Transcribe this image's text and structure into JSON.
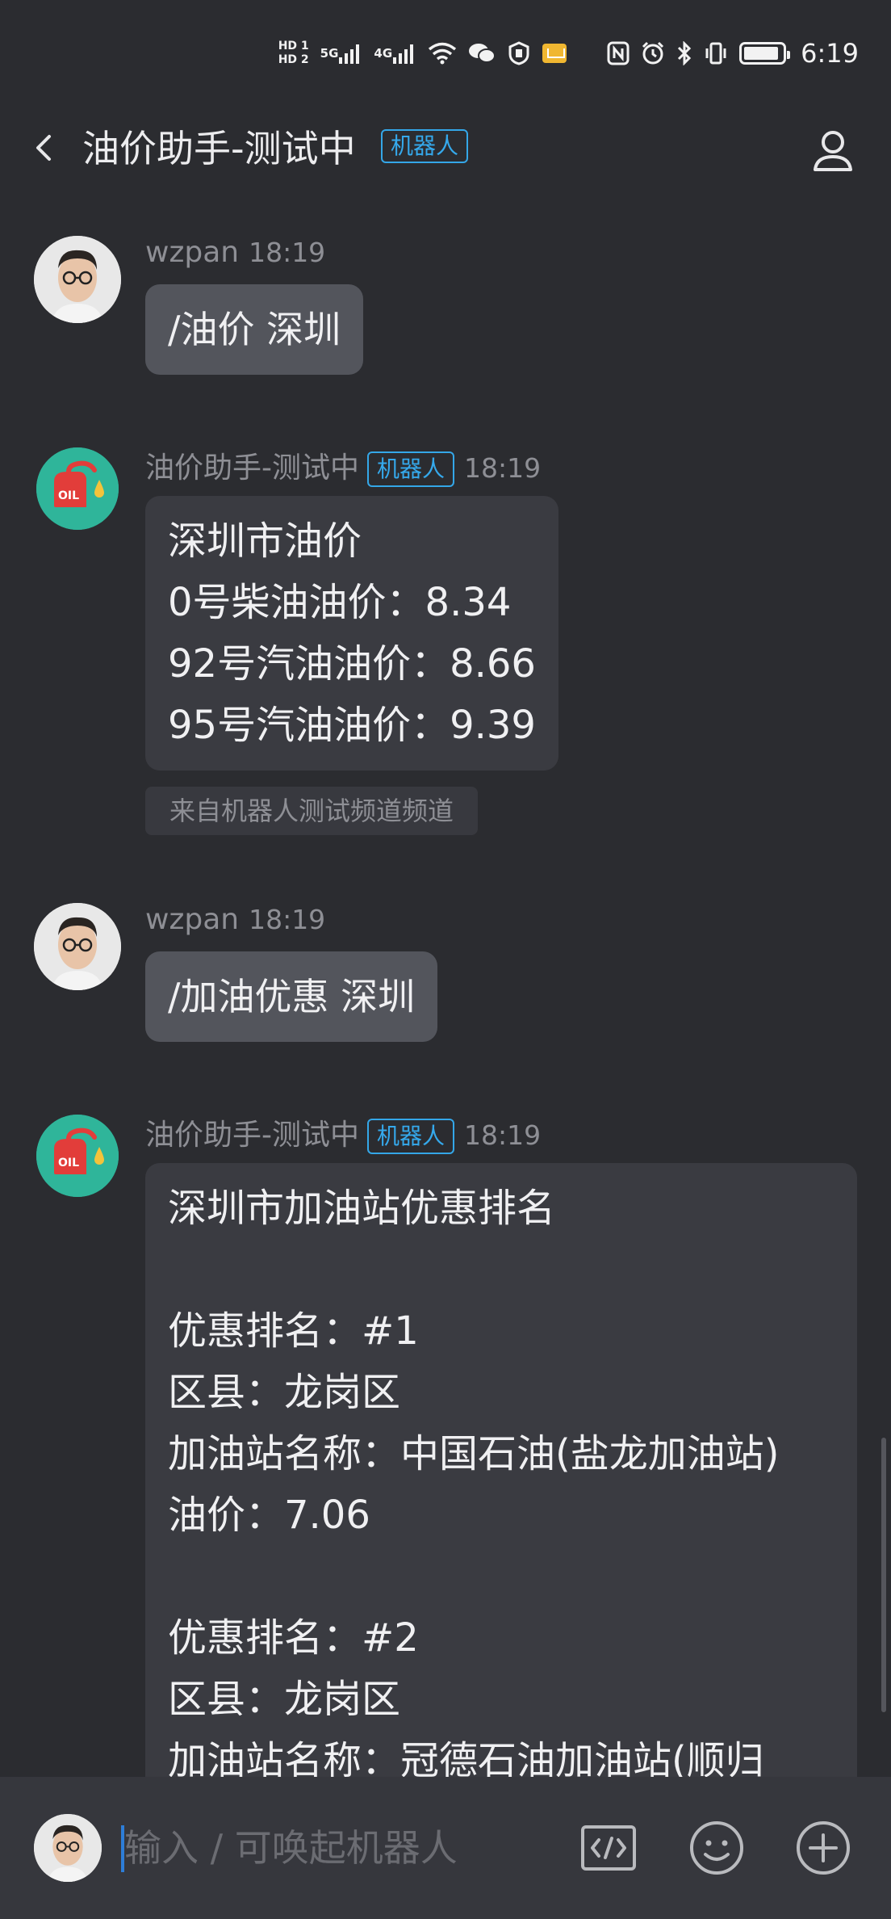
{
  "status_bar": {
    "hd1": "HD 1",
    "hd2": "HD 2",
    "net1": "5G",
    "net2": "4G",
    "time": "6:19",
    "battery_level": 0.9
  },
  "header": {
    "title": "油价助手-测试中",
    "badge": "机器人"
  },
  "messages": [
    {
      "sender": "wzpan",
      "time": "18:19",
      "text": "/油价 深圳"
    },
    {
      "sender": "油价助手-测试中",
      "badge": "机器人",
      "time": "18:19",
      "lines": [
        "深圳市油价",
        "0号柴油油价：8.34",
        "92号汽油油价：8.66",
        "95号汽油油价：9.39"
      ],
      "source": "来自机器人测试频道频道"
    },
    {
      "sender": "wzpan",
      "time": "18:19",
      "text": "/加油优惠 深圳"
    },
    {
      "sender": "油价助手-测试中",
      "badge": "机器人",
      "time": "18:19",
      "lines": [
        "深圳市加油站优惠排名",
        "",
        "优惠排名：#1",
        "区县：龙岗区",
        "加油站名称：中国石油(盐龙加油站)",
        "油价：7.06",
        "",
        "优惠排名：#2",
        "区县：龙岗区",
        "加油站名称：冠德石油加油站(顺归"
      ]
    }
  ],
  "input": {
    "placeholder": "输入 / 可唤起机器人"
  },
  "bot_avatar_label": "OIL"
}
